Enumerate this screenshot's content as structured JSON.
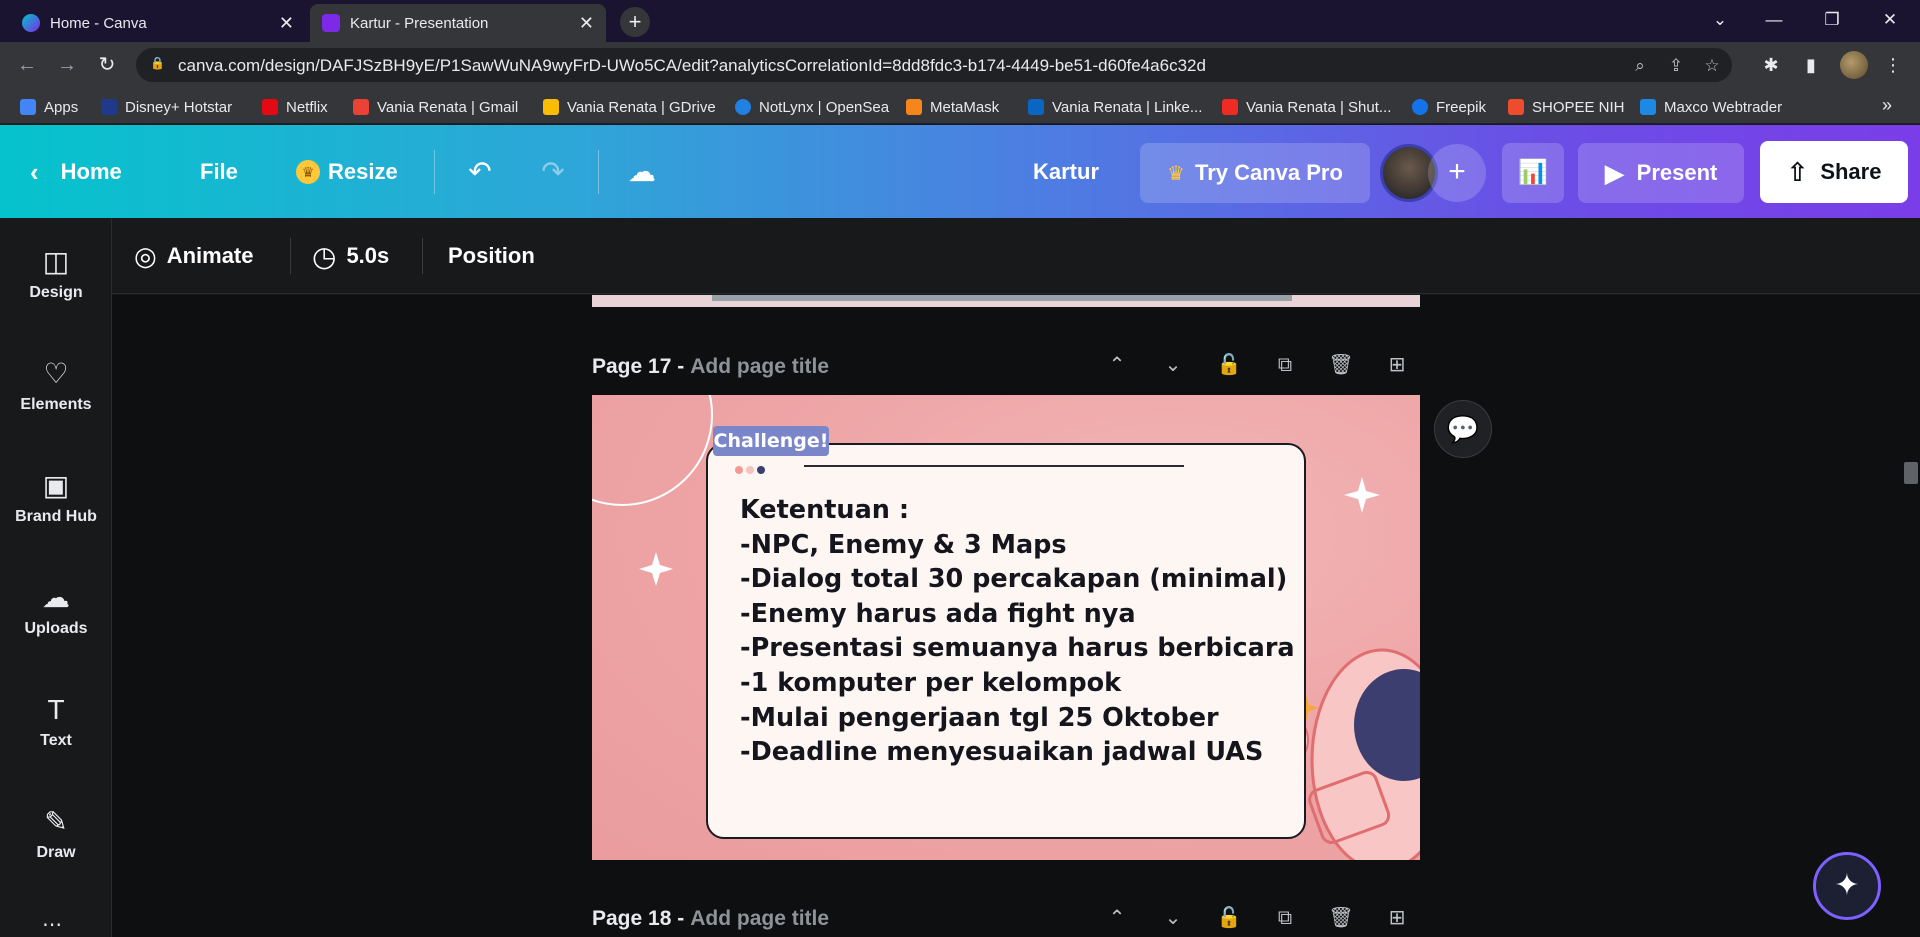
{
  "browser": {
    "tabs": [
      {
        "title": "Home - Canva",
        "active": false
      },
      {
        "title": "Kartur - Presentation",
        "active": true
      }
    ],
    "url": "canva.com/design/DAFJSzBH9yE/P1SawWuNA9wyFrD-UWo5CA/edit?analyticsCorrelationId=8dd8fdc3-b174-4449-be51-d60fe4a6c32d",
    "bookmarks": [
      {
        "label": "Apps",
        "color": "#4285f4"
      },
      {
        "label": "Disney+ Hotstar",
        "color": "#1f3a8a"
      },
      {
        "label": "Netflix",
        "color": "#e50914"
      },
      {
        "label": "Vania Renata | Gmail",
        "color": "#ea4335"
      },
      {
        "label": "Vania Renata | GDrive",
        "color": "#fbbc04"
      },
      {
        "label": "NotLynx | OpenSea",
        "color": "#2081e2"
      },
      {
        "label": "MetaMask",
        "color": "#f6851b"
      },
      {
        "label": "Vania Renata | Linke...",
        "color": "#0a66c2"
      },
      {
        "label": "Vania Renata | Shut...",
        "color": "#ee2b24"
      },
      {
        "label": "Freepik",
        "color": "#1273eb"
      },
      {
        "label": "SHOPEE NIH",
        "color": "#ee4d2d"
      },
      {
        "label": "Maxco Webtrader",
        "color": "#1e88e5"
      }
    ]
  },
  "header": {
    "home": "Home",
    "file": "File",
    "resize": "Resize",
    "doc_title": "Kartur",
    "try_pro": "Try Canva Pro",
    "present": "Present",
    "share": "Share"
  },
  "sidebar": {
    "items": [
      {
        "label": "Design",
        "icon": "layout-icon"
      },
      {
        "label": "Elements",
        "icon": "shapes-icon"
      },
      {
        "label": "Brand Hub",
        "icon": "brand-icon"
      },
      {
        "label": "Uploads",
        "icon": "cloud-upload-icon"
      },
      {
        "label": "Text",
        "icon": "text-icon"
      },
      {
        "label": "Draw",
        "icon": "pen-icon"
      }
    ]
  },
  "context_toolbar": {
    "animate": "Animate",
    "duration": "5.0s",
    "position": "Position"
  },
  "pages": [
    {
      "number": "Page 17 -",
      "title_placeholder": "Add page title"
    },
    {
      "number": "Page 18 -",
      "title_placeholder": "Add page title"
    }
  ],
  "slide": {
    "badge": "Challenge!",
    "lines": [
      "Ketentuan :",
      "-NPC, Enemy & 3 Maps",
      "-Dialog total 30 percakapan (minimal)",
      "-Enemy harus ada fight nya",
      "-Presentasi semuanya harus berbicara",
      "-1 komputer per kelompok",
      "-Mulai pengerjaan tgl 25 Oktober",
      "-Deadline menyesuaikan jadwal UAS"
    ],
    "colors": {
      "background": "#eea5a6",
      "card": "#fdf6f2",
      "badge": "#7b86c9",
      "astronaut": "#f8c6c4"
    }
  }
}
